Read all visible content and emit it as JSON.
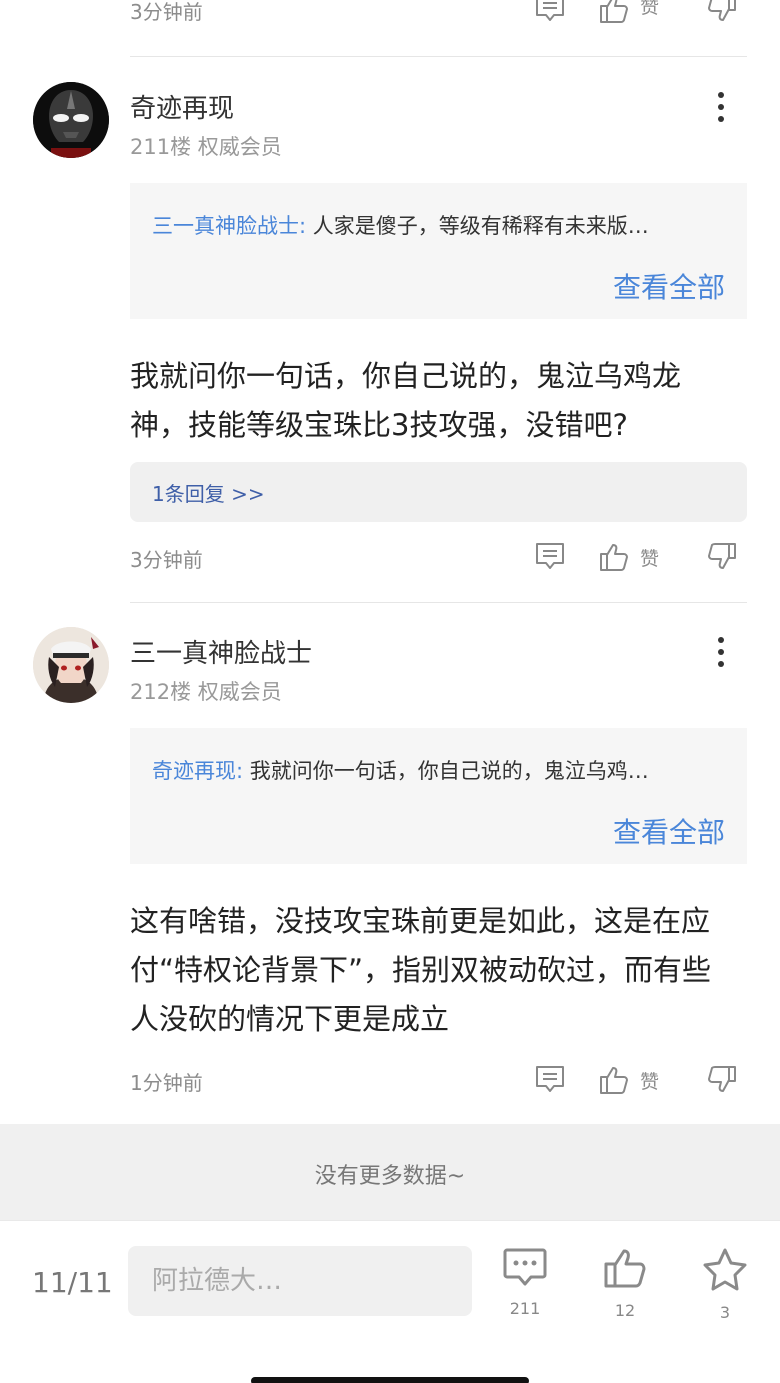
{
  "top_row": {
    "time": "3分钟前",
    "like_label": "赞"
  },
  "comments": [
    {
      "username": "奇迹再现",
      "floor": "211楼",
      "badge": "权威会员",
      "quote_author": "三一真神脸战士:",
      "quote_text": " 人家是傻子，等级有稀释有未来版…",
      "view_all": "查看全部",
      "body_lines": [
        "我就问你一句话，你自己说的，鬼泣乌鸡龙",
        "神，技能等级宝珠比3技攻强，没错吧?"
      ],
      "replies_link": "1条回复 >>",
      "time": "3分钟前",
      "like_label": "赞"
    },
    {
      "username": "三一真神脸战士",
      "floor": "212楼",
      "badge": "权威会员",
      "quote_author": "奇迹再现:",
      "quote_text": " 我就问你一句话，你自己说的，鬼泣乌鸡…",
      "view_all": "查看全部",
      "body_lines": [
        "这有啥错，没技攻宝珠前更是如此，这是在应",
        "付“特权论背景下”，指别双被动砍过，而有些",
        "人没砍的情况下更是成立"
      ],
      "time": "1分钟前",
      "like_label": "赞"
    }
  ],
  "footer": {
    "no_more": "没有更多数据~"
  },
  "bottom_bar": {
    "page_count": "11/11",
    "input_placeholder": "阿拉德大…",
    "comments_count": "211",
    "likes_count": "12",
    "favorites_count": "3"
  },
  "icons": {
    "comment": "comment-bubble-icon",
    "like": "thumb-up-icon",
    "dislike": "thumb-down-icon",
    "more": "more-vertical-icon",
    "star": "star-icon"
  },
  "colors": {
    "link_blue": "#4a86d9",
    "reply_blue": "#3f5fa8",
    "gray_text": "#999999",
    "quote_bg": "#f6f6f6"
  }
}
